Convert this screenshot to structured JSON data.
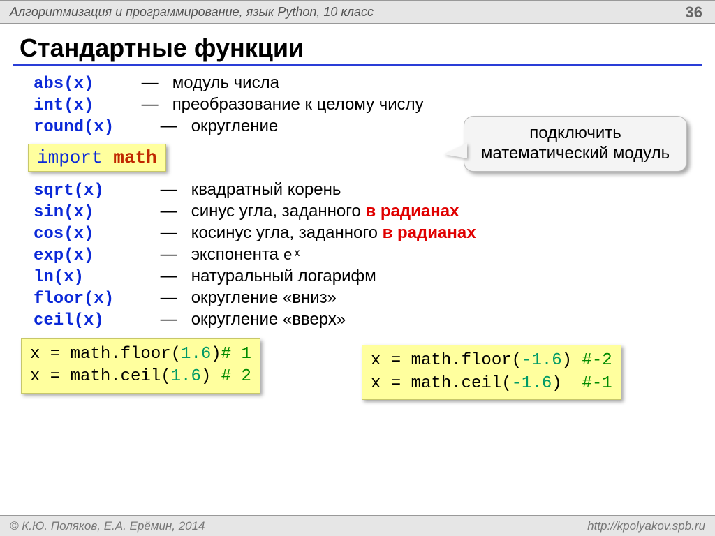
{
  "header": {
    "course": "Алгоритмизация и программирование, язык Python, 10 класс",
    "pagenum": "36"
  },
  "title": "Стандартные функции",
  "callout": "подключить математический модуль",
  "import_line": {
    "kw": "import",
    "mod": "math"
  },
  "top_fns": [
    {
      "sig": "abs(x)",
      "desc": "модуль числа"
    },
    {
      "sig": "int(x)",
      "desc": "преобразование к целому числу"
    },
    {
      "sig": "round(x)",
      "desc": "округление"
    }
  ],
  "math_fns": [
    {
      "sig": "sqrt(x)",
      "desc": "квадратный корень",
      "red": ""
    },
    {
      "sig": "sin(x)",
      "desc": "синус угла, заданного ",
      "red": "в радианах"
    },
    {
      "sig": "cos(x)",
      "desc": "косинус угла, заданного ",
      "red": "в радианах"
    },
    {
      "sig": "exp(x)",
      "desc": "экспонента ",
      "extra_mono": "eˣ"
    },
    {
      "sig": "ln(x)",
      "desc": "натуральный логарифм"
    },
    {
      "sig": "floor(x)",
      "desc": "округление «вниз»"
    },
    {
      "sig": "ceil(x)",
      "desc": "округление «вверх»"
    }
  ],
  "code_left": {
    "l1_lhs": "x = math.",
    "l1_fn": "floor",
    "l1_arg": "1.6",
    "l1_cmt": "# 1",
    "l2_lhs": "x = math.",
    "l2_fn": "ceil",
    "l2_arg": "1.6",
    "l2_cmt": "# 2"
  },
  "code_right": {
    "l1_lhs": "x = math.",
    "l1_fn": "floor",
    "l1_arg": "-1.6",
    "l1_cmt": "#-2",
    "l2_lhs": "x = math.",
    "l2_fn": "ceil",
    "l2_arg": "-1.6",
    "l2_cmt": "#-1"
  },
  "footer": {
    "left": "© К.Ю. Поляков, Е.А. Ерёмин, 2014",
    "right": "http://kpolyakov.spb.ru"
  }
}
